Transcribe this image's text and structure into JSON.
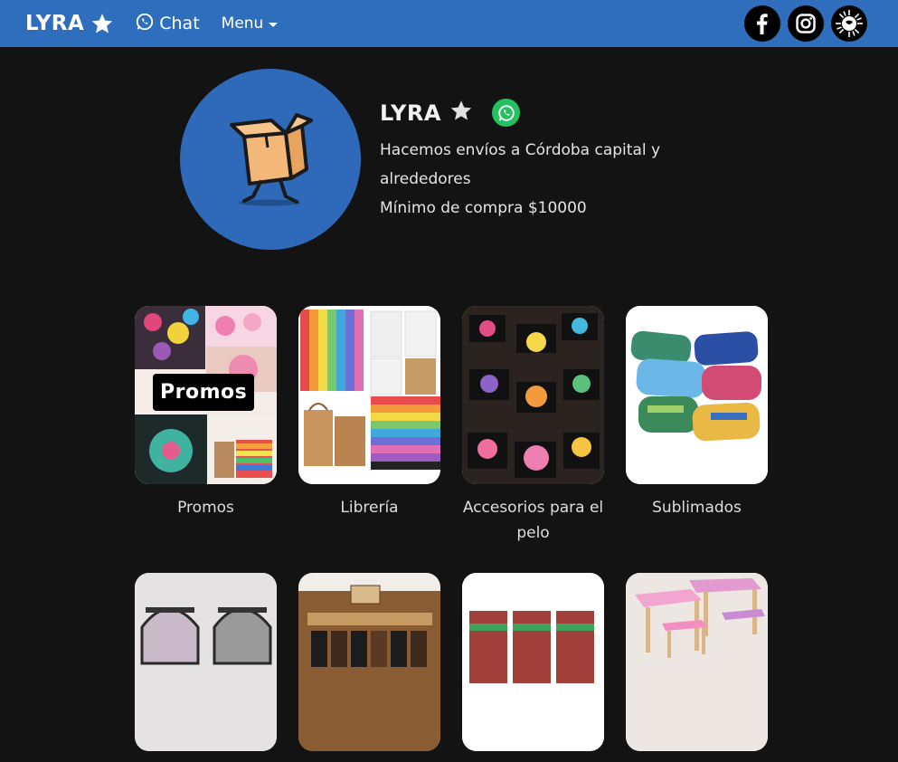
{
  "nav": {
    "brand": "LYRA",
    "chat_label": "Chat",
    "menu_label": "Menu",
    "socials": [
      "facebook-icon",
      "instagram-icon",
      "sun-icon"
    ]
  },
  "profile": {
    "store_name": "LYRA",
    "line1": "Hacemos envíos a Córdoba capital y alrededores",
    "line2": "Mínimo de compra $10000"
  },
  "categories": [
    {
      "label": "Promos",
      "badge": "Promos"
    },
    {
      "label": "Librería"
    },
    {
      "label": "Accesorios para el pelo"
    },
    {
      "label": "Sublimados"
    },
    {
      "label": ""
    },
    {
      "label": ""
    },
    {
      "label": ""
    },
    {
      "label": ""
    }
  ],
  "colors": {
    "nav_bg": "#2f6ebc",
    "page_bg": "#131313",
    "avatar_bg": "#2e6ab9",
    "whatsapp": "#25c160"
  }
}
